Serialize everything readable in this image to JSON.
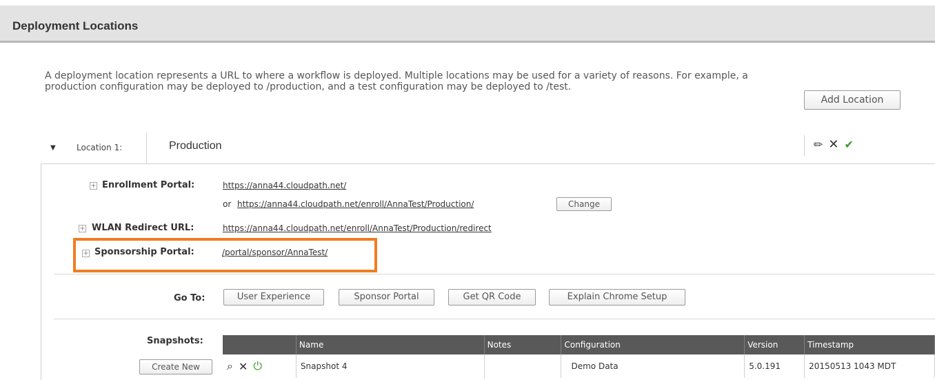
{
  "header": {
    "title": "Deployment Locations"
  },
  "description": "A deployment location represents a URL to where a workflow is deployed. Multiple locations may be used for a variety of reasons. For example, a production configuration may be deployed to /production, and a test configuration may be deployed to /test.",
  "add_location_label": "Add Location",
  "location": {
    "label": "Location 1:",
    "name": "Production",
    "actions": {
      "edit": "pencil-icon",
      "delete": "close-icon",
      "activate": "check-icon"
    },
    "enrollment_portal": {
      "label": "Enrollment Portal:",
      "url": "https://anna44.cloudpath.net/",
      "or_prefix": "or",
      "alt_url": "https://anna44.cloudpath.net/enroll/AnnaTest/Production/",
      "change_label": "Change"
    },
    "wlan_redirect": {
      "label": "WLAN Redirect URL:",
      "url": "https://anna44.cloudpath.net/enroll/AnnaTest/Production/redirect"
    },
    "sponsorship_portal": {
      "label": "Sponsorship Portal:",
      "url": "/portal/sponsor/AnnaTest/"
    },
    "goto": {
      "label": "Go To:",
      "buttons": [
        "User Experience",
        "Sponsor Portal",
        "Get QR Code",
        "Explain Chrome Setup"
      ]
    },
    "snapshots": {
      "label": "Snapshots:",
      "create_label": "Create New",
      "columns": [
        "Name",
        "Notes",
        "Configuration",
        "Version",
        "Timestamp"
      ],
      "rows": [
        {
          "name": "Snapshot 4",
          "notes": "",
          "configuration": "Demo Data",
          "version": "5.0.191",
          "timestamp": "20150513 1043 MDT"
        }
      ]
    }
  },
  "colors": {
    "highlight": "#ef7d22",
    "table_header": "#595959",
    "header_bg": "#e3e3e3"
  }
}
